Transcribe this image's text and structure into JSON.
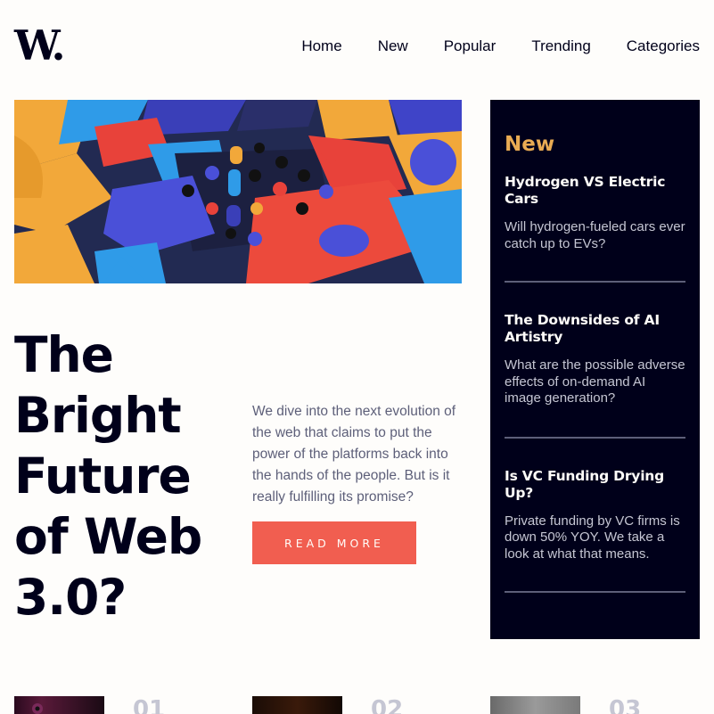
{
  "brand": {
    "logo": "W."
  },
  "nav": {
    "items": [
      "Home",
      "New",
      "Popular",
      "Trending",
      "Categories"
    ]
  },
  "hero": {
    "image_alt": "Colorful 3D geometric blocks",
    "title": "The Bright Future of Web 3.0?",
    "description": "We dive into the next evolution of the web that claims to put the power of the platforms back into the hands of the people. But is it really fulfilling its promise?",
    "cta_label": "READ MORE"
  },
  "sidebar": {
    "heading": "New",
    "items": [
      {
        "title": "Hydrogen VS Electric Cars",
        "text": "Will hydrogen-fueled cars ever catch up to EVs?"
      },
      {
        "title": "The Downsides of AI Artistry",
        "text": "What are the possible adverse effects of on-demand AI image generation?"
      },
      {
        "title": "Is VC Funding Drying Up?",
        "text": "Private funding by VC firms is down 50% YOY. We take a look at what that means."
      }
    ]
  },
  "bottom": {
    "numbers": [
      "01",
      "02",
      "03"
    ]
  },
  "colors": {
    "dark": "#00001a",
    "accent": "#f15e50",
    "gold": "#e9ab53",
    "muted": "#5d5f79"
  }
}
